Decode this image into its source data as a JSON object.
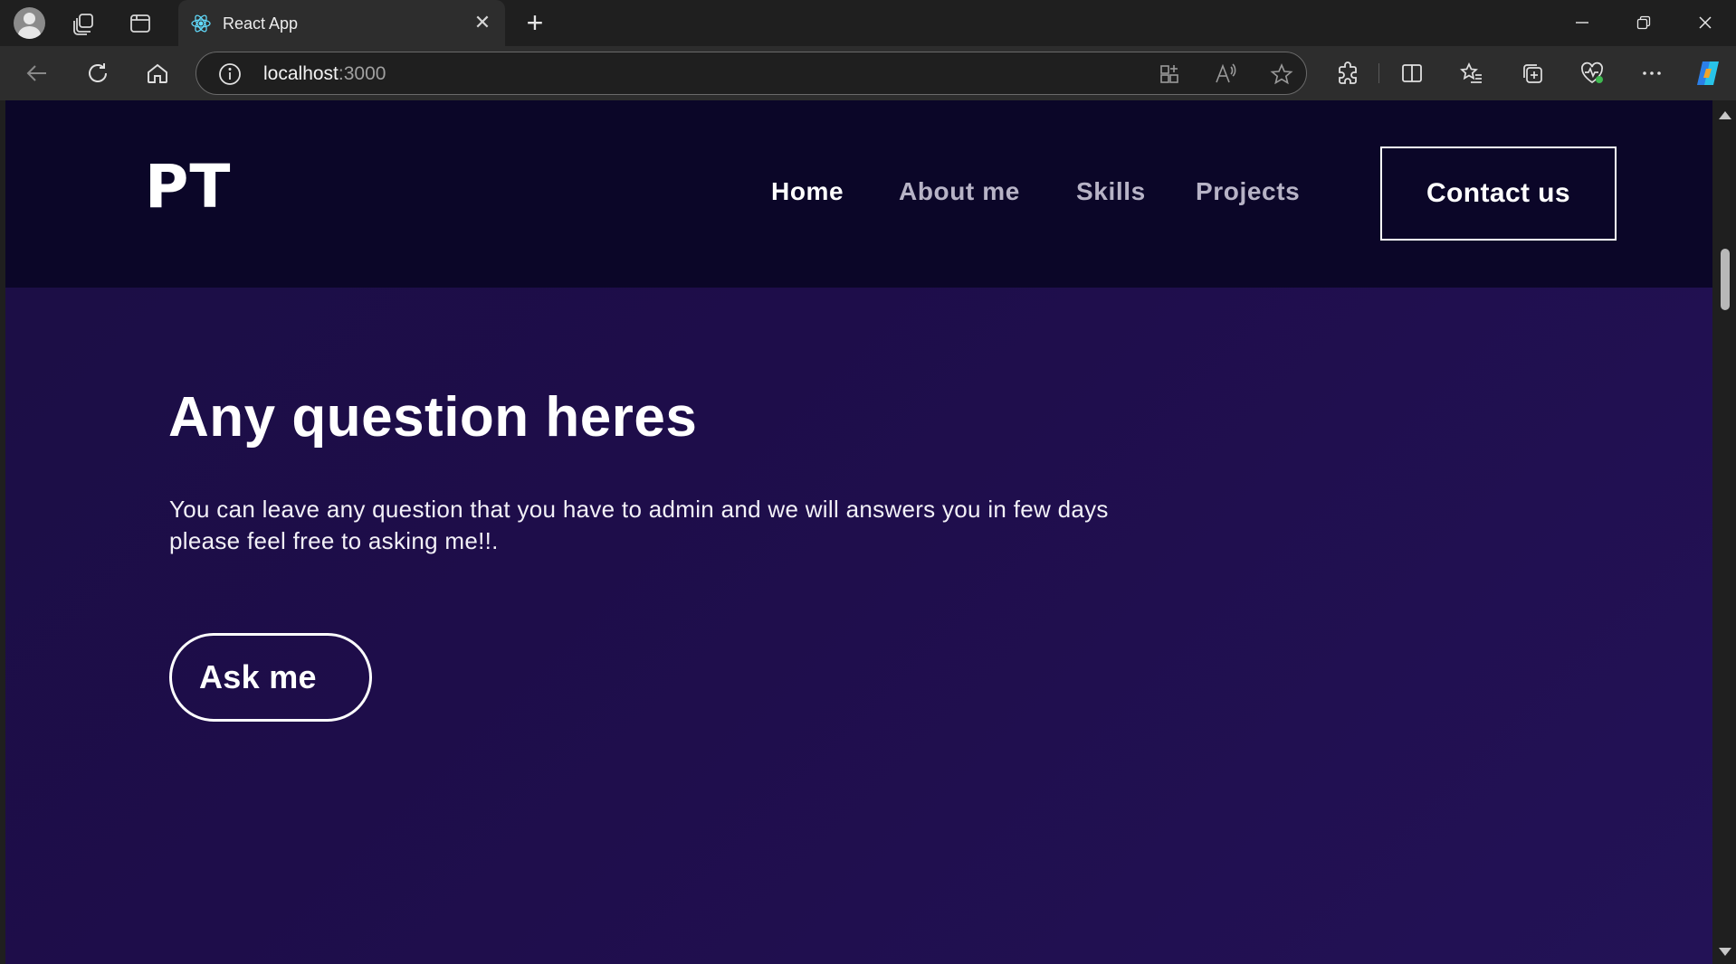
{
  "browser": {
    "tab_title": "React App",
    "url_host": "localhost",
    "url_port": ":3000",
    "icons": {
      "profile": "avatar-icon",
      "workspaces": "workspaces-icon",
      "tab_actions": "tab-actions-icon",
      "favicon": "react-icon",
      "close_tab": "close-icon",
      "new_tab": "plus-icon",
      "back": "back-arrow-icon",
      "reload": "reload-icon",
      "home": "home-icon",
      "site_info": "info-icon",
      "app_available": "apps-icon",
      "read_aloud": "read-aloud-icon",
      "favorite": "star-icon",
      "extensions": "puzzle-icon",
      "split_screen": "split-screen-icon",
      "favorites": "favorites-list-icon",
      "collections": "collections-icon",
      "health": "browser-essentials-icon",
      "more": "more-icon",
      "copilot": "copilot-icon",
      "minimize": "minimize-icon",
      "restore": "restore-icon",
      "close_window": "close-window-icon"
    },
    "close_glyph": "✕",
    "new_tab_glyph": "+"
  },
  "site": {
    "logo": "PT",
    "nav": [
      {
        "label": "Home",
        "active": true
      },
      {
        "label": "About me",
        "active": false
      },
      {
        "label": "Skills",
        "active": false
      },
      {
        "label": "Projects",
        "active": false
      }
    ],
    "contact_label": "Contact us",
    "hero": {
      "title": "Any question heres",
      "text_line1": "You can leave any question that you have to admin and we will answers you in few days",
      "text_line2": "please feel free to asking me!!.",
      "button_label": "Ask me"
    },
    "colors": {
      "header_bg": "#0b0628",
      "body_bg": "#1e0d4a",
      "text": "#ffffff",
      "nav_inactive": "#b7b3c6"
    }
  }
}
